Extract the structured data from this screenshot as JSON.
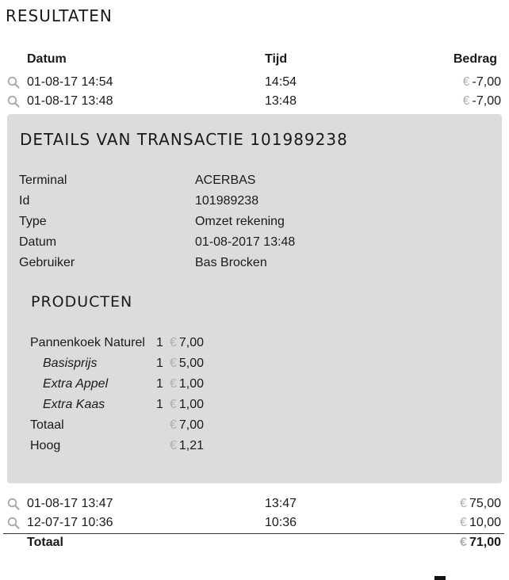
{
  "page": {
    "title": "RESULTATEN"
  },
  "table": {
    "headers": {
      "datum": "Datum",
      "tijd": "Tijd",
      "bedrag": "Bedrag"
    },
    "currency": "€",
    "rows_before": [
      {
        "datum": "01-08-17 14:54",
        "tijd": "14:54",
        "bedrag": "-7,00"
      },
      {
        "datum": "01-08-17 13:48",
        "tijd": "13:48",
        "bedrag": "-7,00"
      }
    ],
    "rows_after": [
      {
        "datum": "01-08-17 13:47",
        "tijd": "13:47",
        "bedrag": "75,00"
      },
      {
        "datum": "12-07-17 10:36",
        "tijd": "10:36",
        "bedrag": "10,00"
      }
    ],
    "total": {
      "label": "Totaal",
      "value": "71,00"
    }
  },
  "detail": {
    "title": "DETAILS VAN TRANSACTIE 101989238",
    "fields": [
      {
        "label": "Terminal",
        "value": "ACERBAS"
      },
      {
        "label": "Id",
        "value": "101989238"
      },
      {
        "label": "Type",
        "value": "Omzet rekening"
      },
      {
        "label": "Datum",
        "value": "01-08-2017 13:48"
      },
      {
        "label": "Gebruiker",
        "value": "Bas Brocken"
      }
    ],
    "products_title": "PRODUCTEN",
    "products": [
      {
        "name": "Pannenkoek Naturel",
        "qty": "1",
        "price": "7,00",
        "sub": false
      },
      {
        "name": "Basisprijs",
        "qty": "1",
        "price": "5,00",
        "sub": true
      },
      {
        "name": "Extra Appel",
        "qty": "1",
        "price": "1,00",
        "sub": true
      },
      {
        "name": "Extra Kaas",
        "qty": "1",
        "price": "1,00",
        "sub": true
      },
      {
        "name": "Totaal",
        "qty": "",
        "price": "7,00",
        "sub": false
      },
      {
        "name": "Hoog",
        "qty": "",
        "price": "1,21",
        "sub": false
      }
    ]
  },
  "icons": {
    "row_icon": "magnifier-icon"
  },
  "colors": {
    "panel_bg": "#dcdcdc",
    "euro_sign": "#b0b0b0",
    "icon": "#a8a8a8"
  }
}
